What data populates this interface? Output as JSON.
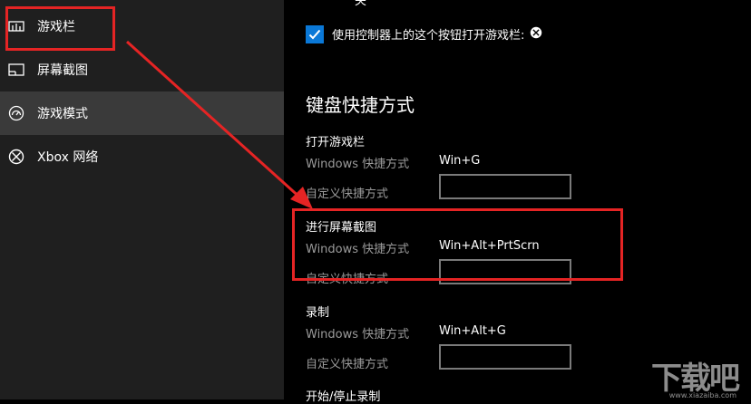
{
  "sidebar": {
    "items": [
      {
        "label": "游戏栏",
        "icon": "game-bar-icon"
      },
      {
        "label": "屏幕截图",
        "icon": "screenshot-icon"
      },
      {
        "label": "游戏模式",
        "icon": "game-mode-icon"
      },
      {
        "label": "Xbox 网络",
        "icon": "xbox-icon"
      }
    ],
    "selected_index": 2
  },
  "main": {
    "top_cut_text": "关",
    "checkbox": {
      "label": "使用控制器上的这个按钮打开游戏栏:",
      "checked": true,
      "icon": "xbox-icon"
    },
    "section_title": "键盘快捷方式",
    "groups": [
      {
        "title": "打开游戏栏",
        "windows_label": "Windows 快捷方式",
        "windows_value": "Win+G",
        "custom_label": "自定义快捷方式"
      },
      {
        "title": "进行屏幕截图",
        "windows_label": "Windows 快捷方式",
        "windows_value": "Win+Alt+PrtScrn",
        "custom_label": "自定义快捷方式"
      },
      {
        "title": "录制",
        "windows_label": "Windows 快捷方式",
        "windows_value": "Win+Alt+G",
        "custom_label": "自定义快捷方式"
      },
      {
        "title": "开始/停止录制"
      }
    ]
  },
  "watermark": {
    "text": "下载吧",
    "sub": "www.xiazaiba.com"
  },
  "colors": {
    "accent": "#0a78d7",
    "annotation": "#e52424",
    "sidebar_bg": "#1f1f1f",
    "selected_bg": "#3a3a3a"
  }
}
